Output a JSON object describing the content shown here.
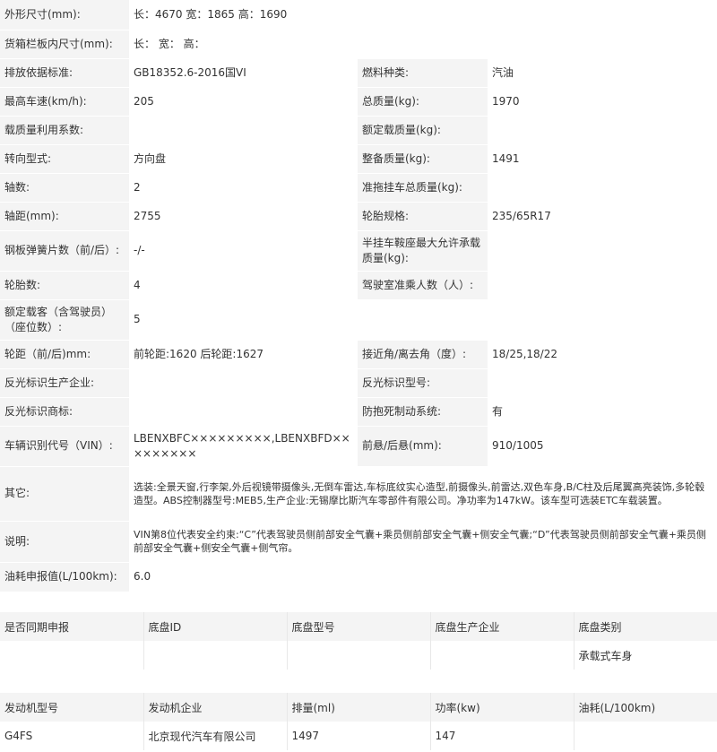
{
  "specs": {
    "dimensions_label": "外形尺寸(mm):",
    "dimensions_value": "长：4670 宽：1865 高：1690",
    "cargo_box_label": "货箱栏板内尺寸(mm):",
    "cargo_box_value": "长： 宽： 高：",
    "emission_label": "排放依据标准:",
    "emission_value": "GB18352.6-2016国VI",
    "fuel_type_label": "燃料种类:",
    "fuel_type_value": "汽油",
    "max_speed_label": "最高车速(km/h):",
    "max_speed_value": "205",
    "total_mass_label": "总质量(kg):",
    "total_mass_value": "1970",
    "load_util_label": "载质量利用系数:",
    "load_util_value": "",
    "rated_load_label": "额定载质量(kg):",
    "rated_load_value": "",
    "steering_label": "转向型式:",
    "steering_value": "方向盘",
    "curb_mass_label": "整备质量(kg):",
    "curb_mass_value": "1491",
    "axles_label": "轴数:",
    "axles_value": "2",
    "trailer_mass_label": "准拖挂车总质量(kg):",
    "trailer_mass_value": "",
    "wheelbase_label": "轴距(mm):",
    "wheelbase_value": "2755",
    "tire_label": "轮胎规格:",
    "tire_value": "235/65R17",
    "leaf_spring_label": "钢板弹簧片数（前/后）:",
    "leaf_spring_value": "-/-",
    "saddle_label": "半挂车鞍座最大允许承载质量(kg):",
    "saddle_value": "",
    "tire_count_label": "轮胎数:",
    "tire_count_value": "4",
    "cab_passengers_label": "驾驶室准乘人数（人）:",
    "cab_passengers_value": "",
    "rated_passengers_label": "额定载客（含驾驶员）（座位数）:",
    "rated_passengers_value": "5",
    "track_label": "轮距（前/后)mm:",
    "track_value": "前轮距:1620 后轮距:1627",
    "angles_label": "接近角/离去角（度）:",
    "angles_value": "18/25,18/22",
    "reflector_maker_label": "反光标识生产企业:",
    "reflector_maker_value": "",
    "reflector_model_label": "反光标识型号:",
    "reflector_model_value": "",
    "reflector_brand_label": "反光标识商标:",
    "reflector_brand_value": "",
    "abs_label": "防抱死制动系统:",
    "abs_value": "有",
    "vin_label": "车辆识别代号（VIN）:",
    "vin_value": "LBENXBFC×××××××××,LBENXBFD×××××××××",
    "overhang_label": "前悬/后悬(mm):",
    "overhang_value": "910/1005",
    "other_label": "其它:",
    "other_value": "选装:全景天窗,行李架,外后视镜带摄像头,无倒车雷达,车标底纹实心造型,前摄像头,前雷达,双色车身,B/C柱及后尾翼高亮装饰,多轮毂造型。ABS控制器型号:MEB5,生产企业:无锡摩比斯汽车零部件有限公司。净功率为147kW。该车型可选装ETC车载装置。",
    "note_label": "说明:",
    "note_value": "VIN第8位代表安全约束:“C”代表驾驶员侧前部安全气囊+乘员侧前部安全气囊+侧安全气囊;“D”代表驾驶员侧前部安全气囊+乘员侧前部安全气囊+侧安全气囊+侧气帘。",
    "fuel_consumption_label": "油耗申报值(L/100km):",
    "fuel_consumption_value": "6.0"
  },
  "chassis": {
    "headers": [
      "是否同期申报",
      "底盘ID",
      "底盘型号",
      "底盘生产企业",
      "底盘类别"
    ],
    "row": [
      "",
      "",
      "",
      "",
      "承载式车身"
    ]
  },
  "engine": {
    "headers": [
      "发动机型号",
      "发动机企业",
      "排量(ml)",
      "功率(kw)",
      "油耗(L/100km)"
    ],
    "row": [
      "G4FS",
      "北京现代汽车有限公司",
      "1497",
      "147",
      ""
    ]
  }
}
